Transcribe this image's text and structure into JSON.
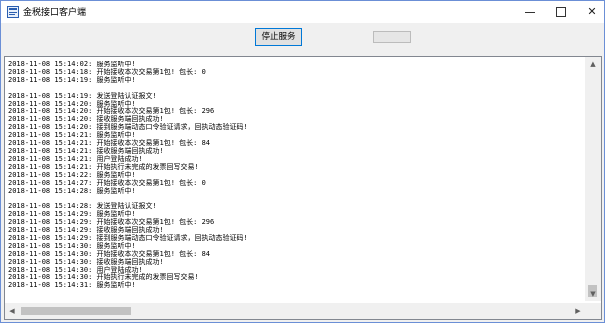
{
  "window": {
    "title": "金税接口客户端",
    "controls": {
      "minimize": "",
      "maximize": "",
      "close": "✕"
    }
  },
  "toolbar": {
    "stop_button_label": "停止服务",
    "progress_fraction": 0.0
  },
  "log": {
    "lines": [
      "2018-11-08 15:14:02: 服务监听中!",
      "2018-11-08 15:14:18: 开始接收本次交易第1包! 包长: 0",
      "2018-11-08 15:14:19: 服务监听中!",
      "",
      "2018-11-08 15:14:19: 发送登陆认证报文!",
      "2018-11-08 15:14:20: 服务监听中!",
      "2018-11-08 15:14:20: 开始接收本次交易第1包! 包长: 296",
      "2018-11-08 15:14:20: 接收服务端回执成功!",
      "2018-11-08 15:14:20: 接到服务端动态口令验证请求，回执动态验证码!",
      "2018-11-08 15:14:21: 服务监听中!",
      "2018-11-08 15:14:21: 开始接收本次交易第1包! 包长: 84",
      "2018-11-08 15:14:21: 接收服务端回执成功!",
      "2018-11-08 15:14:21: 用户登陆成功!",
      "2018-11-08 15:14:21: 开始执行未完成的发票回写交易!",
      "2018-11-08 15:14:22: 服务监听中!",
      "2018-11-08 15:14:27: 开始接收本次交易第1包! 包长: 0",
      "2018-11-08 15:14:28: 服务监听中!",
      "",
      "2018-11-08 15:14:28: 发送登陆认证报文!",
      "2018-11-08 15:14:29: 服务监听中!",
      "2018-11-08 15:14:29: 开始接收本次交易第1包! 包长: 296",
      "2018-11-08 15:14:29: 接收服务端回执成功!",
      "2018-11-08 15:14:29: 接到服务端动态口令验证请求，回执动态验证码!",
      "2018-11-08 15:14:30: 服务监听中!",
      "2018-11-08 15:14:30: 开始接收本次交易第1包! 包长: 84",
      "2018-11-08 15:14:30: 接收服务端回执成功!",
      "2018-11-08 15:14:30: 用户登陆成功!",
      "2018-11-08 15:14:30: 开始执行未完成的发票回写交易!",
      "2018-11-08 15:14:31: 服务监听中!"
    ]
  },
  "scrollbars": {
    "up_arrow": "▲",
    "down_arrow": "▼",
    "left_arrow": "◀",
    "right_arrow": "▶"
  },
  "icons": {
    "app": "app-icon",
    "minimize": "minimize-icon",
    "maximize": "maximize-icon",
    "close": "close-icon"
  },
  "colors": {
    "focus_border": "#0078d7",
    "progress_fill": "#06b025"
  }
}
